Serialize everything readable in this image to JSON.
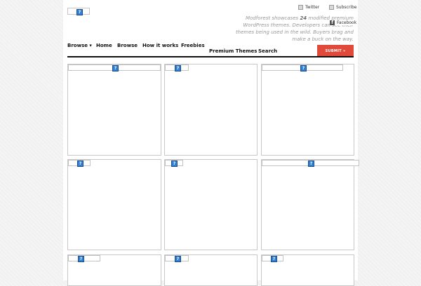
{
  "header": {
    "logo_icon": "broken-image-icon",
    "social": {
      "twitter": "Twitter",
      "subscribe": "Subscribe",
      "facebook": "Facebook"
    },
    "tagline": {
      "prefix": "Modforest showcases ",
      "count": "24",
      "suffix": " modified premium WordPress themes. Developers can see their themes being used in the wild. Buyers brag and make a buck on the way."
    }
  },
  "nav": {
    "browse_dropdown": "Browse ▾",
    "home": "Home",
    "browse": "Browse",
    "how_it_works": "How it works",
    "freebies": "Freebies",
    "premium_themes": "Premium Themes",
    "search": "Search",
    "submit": "SUBMIT »"
  },
  "colors": {
    "submit_bg": "#e14a3b",
    "rule": "#111111",
    "card_border": "#c8c8c8"
  },
  "grid": {
    "card_count": 9,
    "thumb_icon": "broken-image-icon"
  }
}
